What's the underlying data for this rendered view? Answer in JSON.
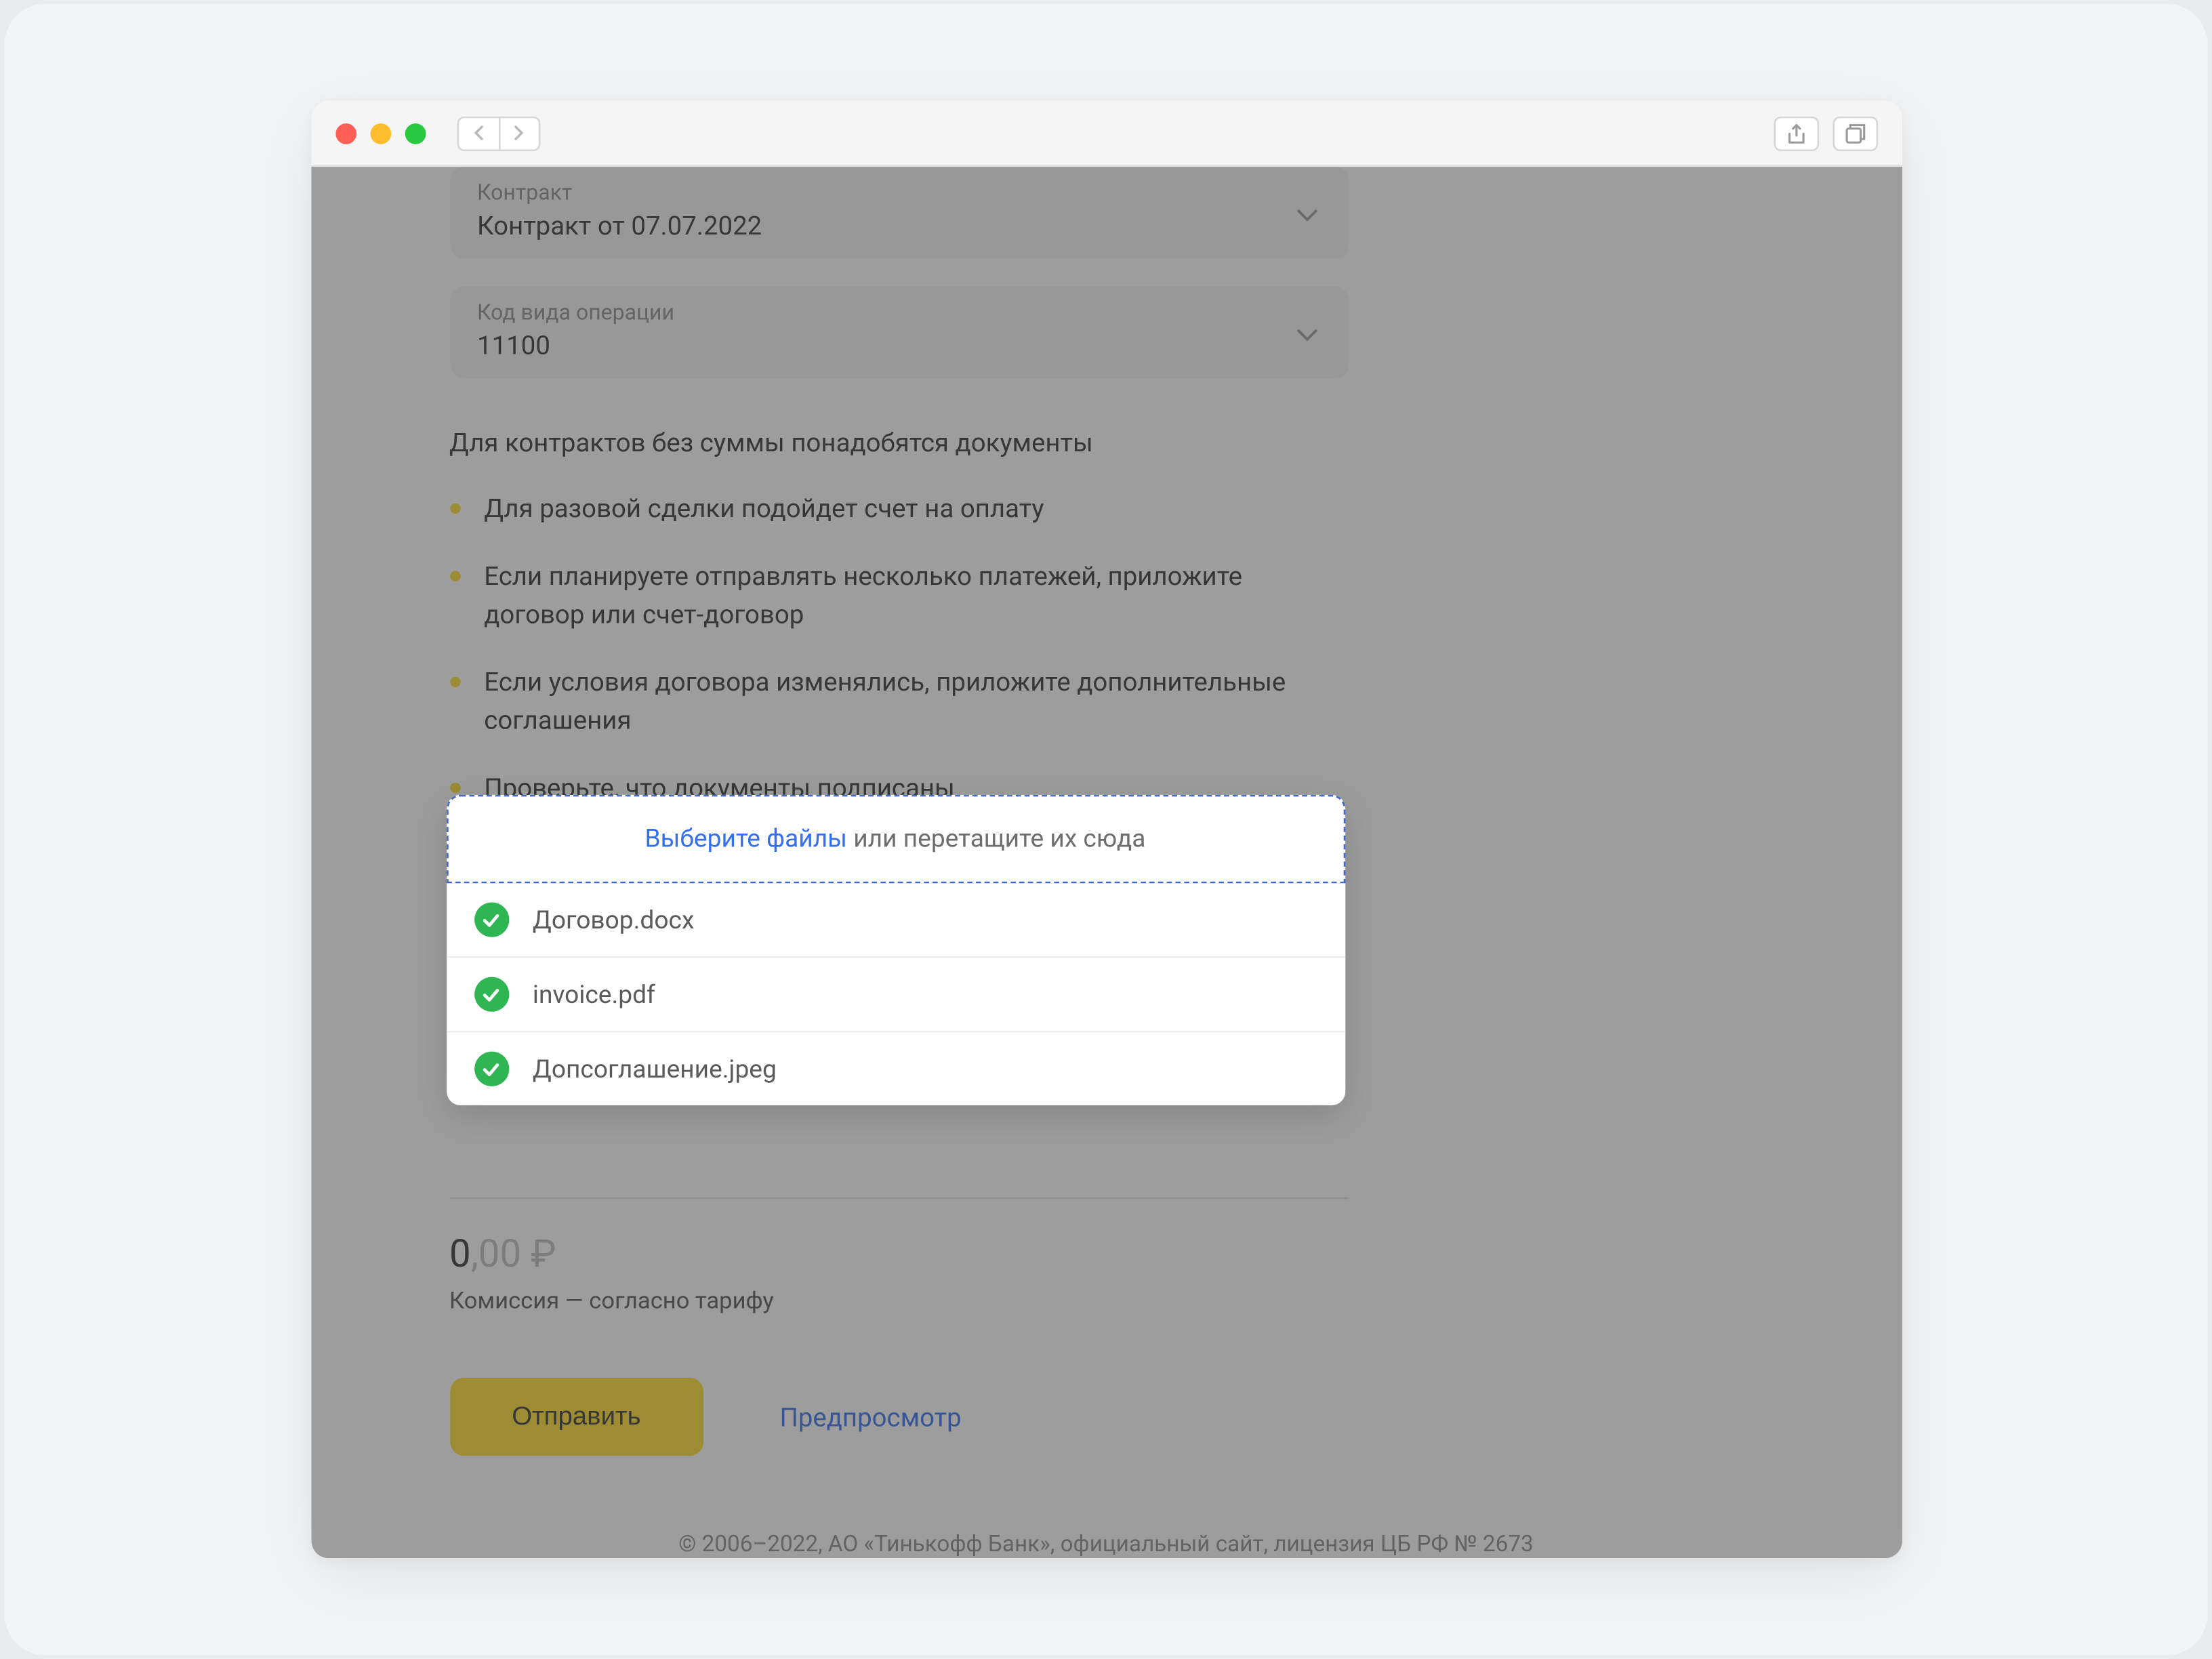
{
  "form": {
    "contract": {
      "label": "Контракт",
      "value": "Контракт от 07.07.2022"
    },
    "operation_code": {
      "label": "Код вида операции",
      "value": "11100"
    }
  },
  "info_text": "Для контрактов без суммы понадобятся документы",
  "bullets": [
    "Для разовой сделки подойдет счет на оплату",
    "Если планируете отправлять несколько платежей, приложите договор или счет-договор",
    "Если условия договора изменялись, приложите дополнительные соглашения",
    "Проверьте, что документы подписаны"
  ],
  "upload": {
    "link_text": "Выберите файлы",
    "rest_text": " или перетащите их сюда",
    "files": [
      "Договор.docx",
      "invoice.pdf",
      "Допсоглашение.jpeg"
    ]
  },
  "summary": {
    "amount_int": "0",
    "amount_dec": ",00 ₽",
    "commission": "Комиссия — согласно тарифу"
  },
  "actions": {
    "submit": "Отправить",
    "preview": "Предпросмотр"
  },
  "footer": "© 2006–2022, АО «Тинькофф Банк», официальный сайт, лицензия ЦБ РФ № 2673"
}
